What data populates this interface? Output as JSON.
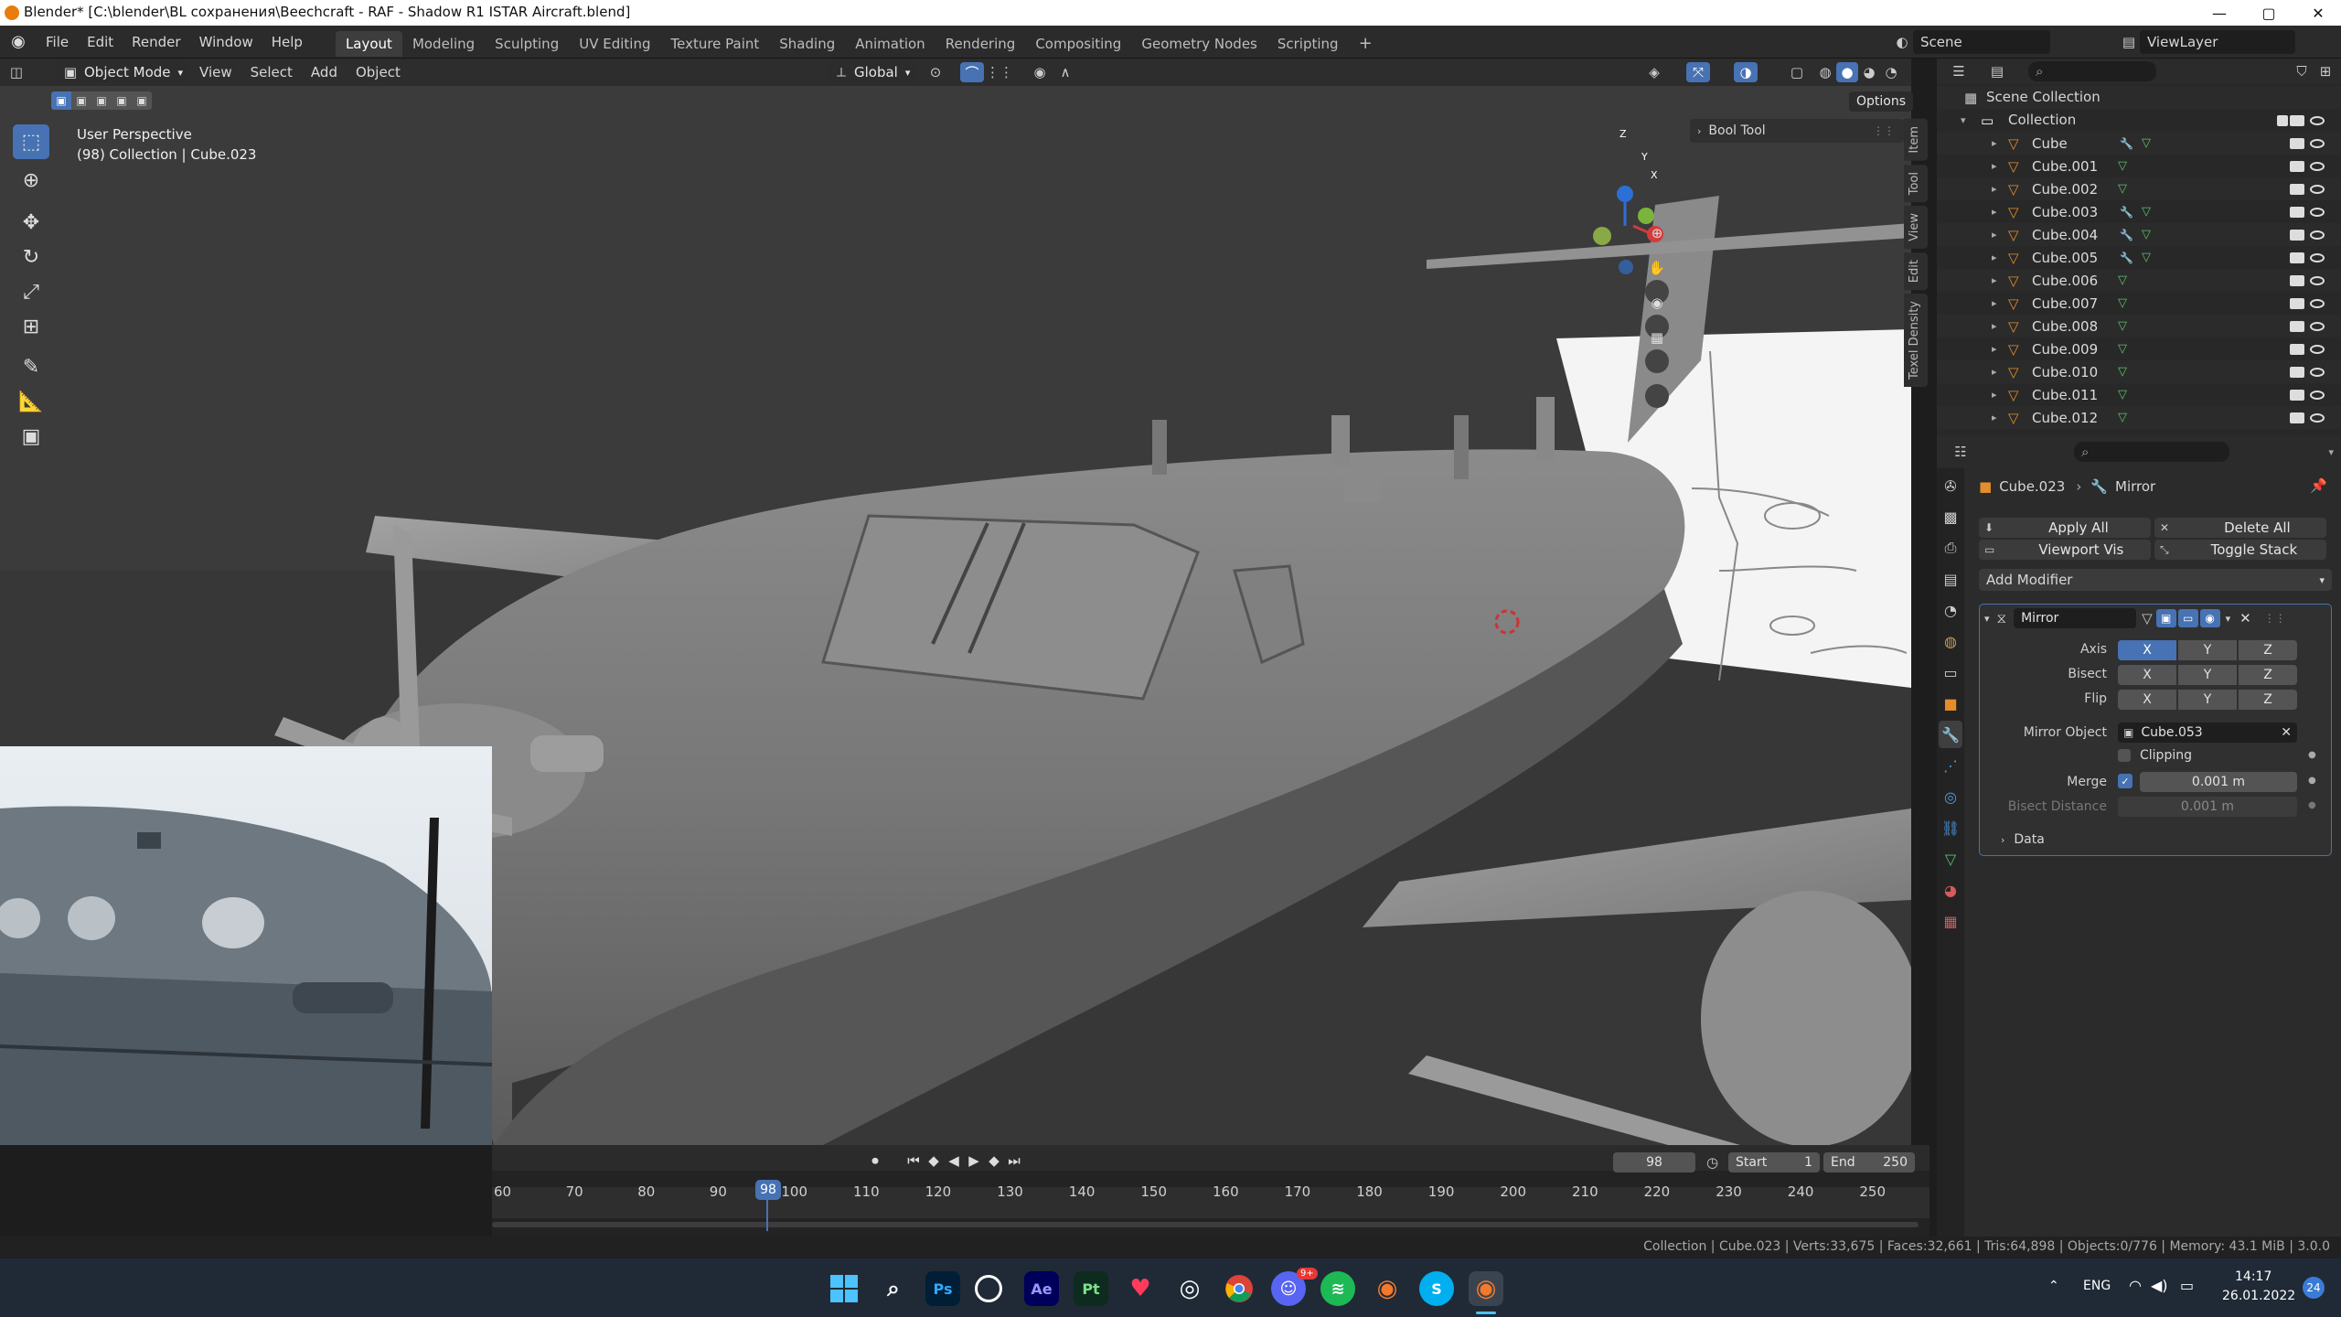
{
  "titlebar": {
    "title": "Blender* [C:\\blender\\BL сохранения\\Beechcraft - RAF - Shadow R1 ISTAR Aircraft.blend]",
    "minimize": "—",
    "maximize": "▢",
    "close": "✕"
  },
  "menu": {
    "items": [
      "File",
      "Edit",
      "Render",
      "Window",
      "Help"
    ],
    "workspaces": [
      "Layout",
      "Modeling",
      "Sculpting",
      "UV Editing",
      "Texture Paint",
      "Shading",
      "Animation",
      "Rendering",
      "Compositing",
      "Geometry Nodes",
      "Scripting"
    ],
    "active_workspace": "Layout",
    "add_workspace": "+",
    "scene": "Scene",
    "view_layer": "ViewLayer"
  },
  "viewport": {
    "mode": "Object Mode",
    "menus": [
      "View",
      "Select",
      "Add",
      "Object"
    ],
    "orientation": "Global",
    "options": "Options",
    "overlay_line1": "User Perspective",
    "overlay_line2": "(98) Collection | Cube.023",
    "bool_tool": "Bool Tool",
    "side_tabs": [
      "Item",
      "Tool",
      "View",
      "Edit",
      "Texel Density"
    ],
    "axes": {
      "z": "Z",
      "y": "Y",
      "x": "X"
    }
  },
  "outliner": {
    "search_placeholder": "",
    "scene_collection": "Scene Collection",
    "collection": "Collection",
    "objects": [
      "Cube",
      "Cube.001",
      "Cube.002",
      "Cube.003",
      "Cube.004",
      "Cube.005",
      "Cube.006",
      "Cube.007",
      "Cube.008",
      "Cube.009",
      "Cube.010",
      "Cube.011",
      "Cube.012"
    ]
  },
  "properties": {
    "object": "Cube.023",
    "modifier_breadcrumb": "Mirror",
    "apply_all": "Apply All",
    "delete_all": "Delete All",
    "viewport_vis": "Viewport Vis",
    "toggle_stack": "Toggle Stack",
    "add_modifier": "Add Modifier",
    "modifier_name": "Mirror",
    "axis_label": "Axis",
    "bisect_label": "Bisect",
    "flip_label": "Flip",
    "xyz": [
      "X",
      "Y",
      "Z"
    ],
    "mirror_object_label": "Mirror Object",
    "mirror_object": "Cube.053",
    "clipping": "Clipping",
    "merge_label": "Merge",
    "merge_value": "0.001 m",
    "bisect_distance_label": "Bisect Distance",
    "bisect_distance_value": "0.001 m",
    "data": "Data"
  },
  "timeline": {
    "current_frame": "98",
    "start_label": "Start",
    "start": "1",
    "end_label": "End",
    "end": "250",
    "ticks": [
      "60",
      "70",
      "80",
      "90",
      "100",
      "110",
      "120",
      "130",
      "140",
      "150",
      "160",
      "170",
      "180",
      "190",
      "200",
      "210",
      "220",
      "230",
      "240",
      "250"
    ],
    "playhead": "98"
  },
  "status": {
    "text": "Collection | Cube.023 | Verts:33,675 | Faces:32,661 | Tris:64,898 | Objects:0/776 | Memory: 43.1 MiB | 3.0.0"
  },
  "taskbar": {
    "apps": [
      "Ps",
      "Ae",
      "Pt",
      "S"
    ],
    "badge": "9+",
    "lang": "ENG",
    "time": "14:17",
    "date": "26.01.2022",
    "notif": "24"
  }
}
